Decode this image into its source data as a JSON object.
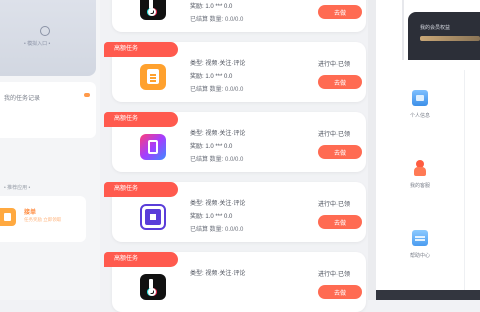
{
  "left": {
    "banner_text": "• 模拟入口 •",
    "row_label": "我的任务记录",
    "section_title": "• 推荐应用 •",
    "app": {
      "title": "接单",
      "subtitle": "任务奖励 立即领取"
    }
  },
  "cards": [
    {
      "ribbon": "",
      "logo": "tiktok-logo-icon",
      "line1": "",
      "line2": "奖励: 1.0 *** 0.0",
      "line3": "已结算 数量: 0.0/0.0",
      "status": "",
      "button": "去做"
    },
    {
      "ribbon": "高额任务",
      "logo": "document-logo-icon",
      "line1": "类型: 视频·关注·评论",
      "line2": "奖励: 1.0 *** 0.0",
      "line3": "已结算 数量: 0.0/0.0",
      "status": "进行中·已领",
      "button": "去做"
    },
    {
      "ribbon": "高额任务",
      "logo": "gradient-app-logo-icon",
      "line1": "类型: 视频·关注·评论",
      "line2": "奖励: 1.0 *** 0.0",
      "line3": "已结算 数量: 0.0/0.0",
      "status": "进行中·已领",
      "button": "去做"
    },
    {
      "ribbon": "高额任务",
      "logo": "square-app-logo-icon",
      "line1": "类型: 视频·关注·评论",
      "line2": "奖励: 1.0 *** 0.0",
      "line3": "已结算 数量: 0.0/0.0",
      "status": "进行中·已领",
      "button": "去做"
    },
    {
      "ribbon": "高额任务",
      "logo": "tiktok-logo-icon",
      "line1": "类型: 视频·关注·评论",
      "line2": "",
      "line3": "",
      "status": "进行中·已领",
      "button": "去做"
    }
  ],
  "right": {
    "card_title": "我的会员权益",
    "items": [
      {
        "label": "个人信息",
        "icon": "profile-card-icon"
      },
      {
        "label": "我的客服",
        "icon": "customer-service-icon"
      },
      {
        "label": "帮助中心",
        "icon": "help-center-icon"
      }
    ]
  },
  "colors": {
    "accent": "#ff5a4e",
    "button": "#ff6b52",
    "dark_card": "#2c2f38",
    "gold": "#c9a777"
  }
}
